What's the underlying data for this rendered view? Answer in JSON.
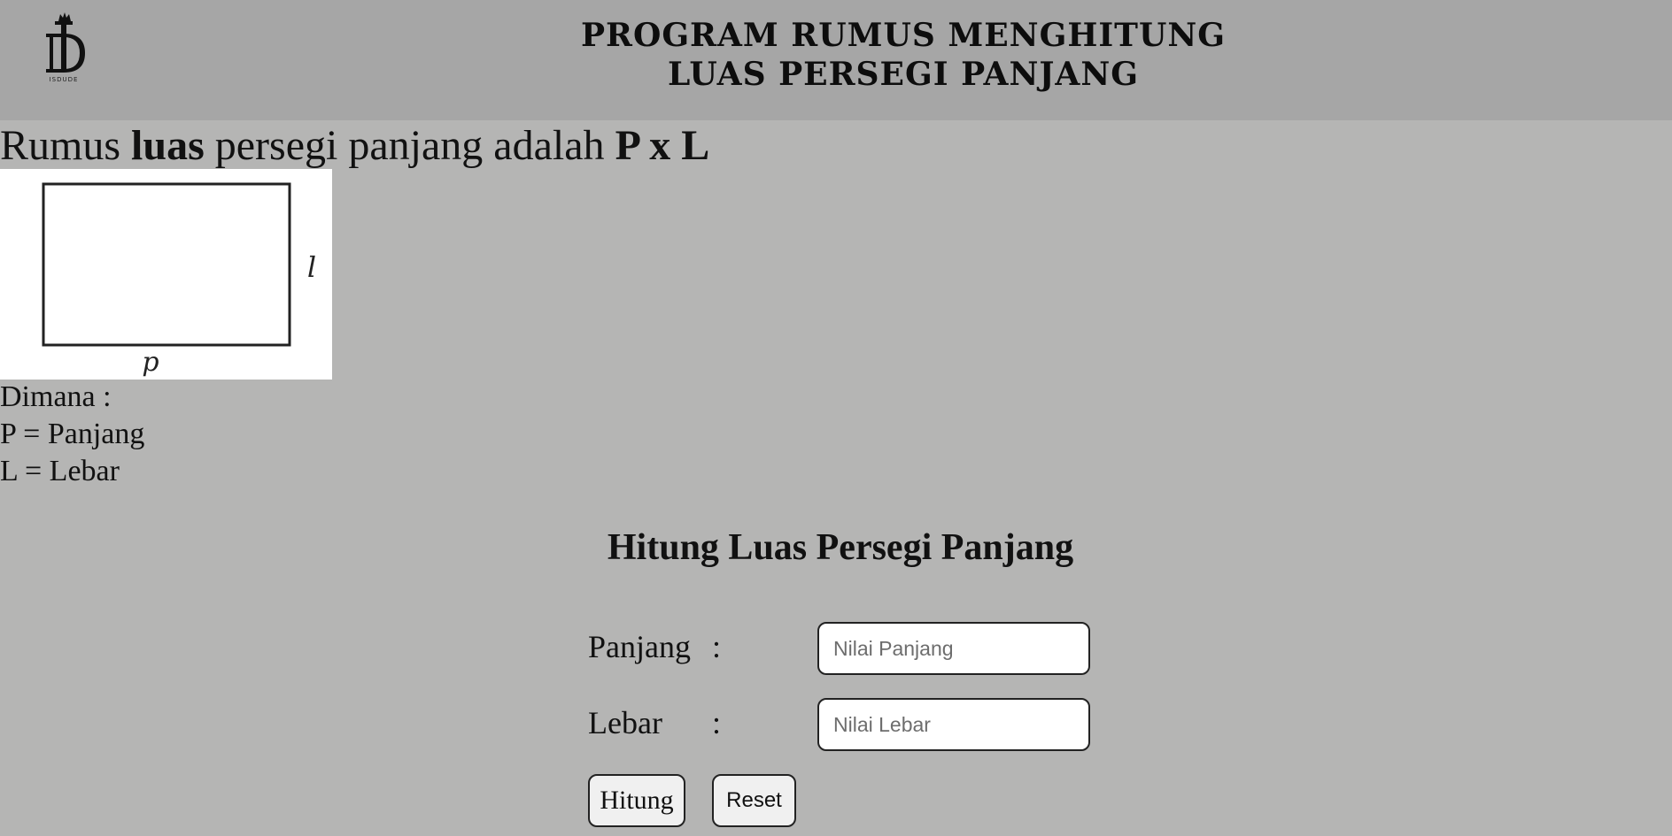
{
  "header": {
    "logo_text": "ISDUDE",
    "title_line1": "PROGRAM RUMUS MENGHITUNG",
    "title_line2": "LUAS PERSEGI PANJANG"
  },
  "formula": {
    "prefix": "Rumus ",
    "emphasis": "luas",
    "middle": " persegi panjang adalah ",
    "expression": "P x L"
  },
  "diagram": {
    "side_label": "l",
    "bottom_label": "p"
  },
  "description": {
    "heading": "Dimana :",
    "line1": "P = Panjang",
    "line2": "L = Lebar"
  },
  "calculator": {
    "title": "Hitung Luas Persegi Panjang",
    "panjang_label": "Panjang",
    "lebar_label": "Lebar",
    "colon": ":",
    "panjang_placeholder": "Nilai Panjang",
    "lebar_placeholder": "Nilai Lebar",
    "hitung_label": "Hitung",
    "reset_label": "Reset"
  }
}
